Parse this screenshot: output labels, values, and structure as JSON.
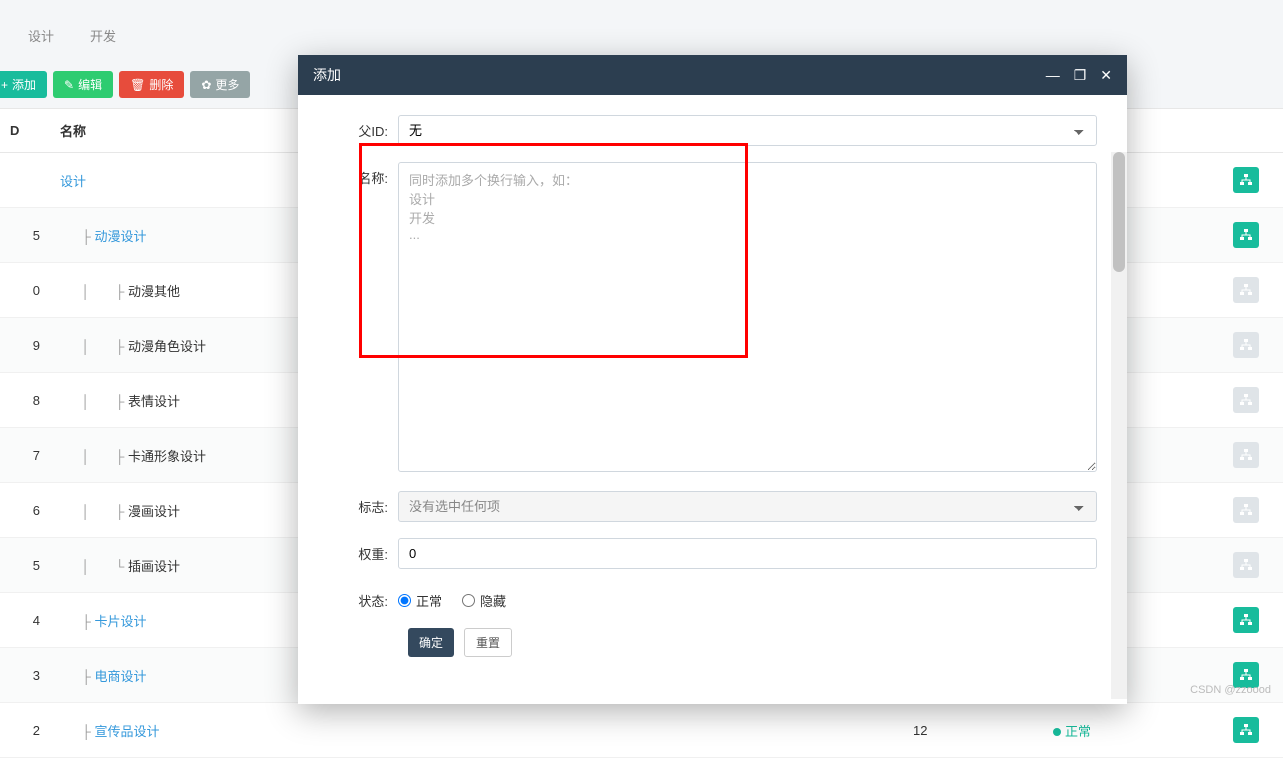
{
  "top_tabs": [
    "设计",
    "开发"
  ],
  "toolbar": {
    "add": "添加",
    "edit": "编辑",
    "delete": "删除",
    "more": "更多"
  },
  "table": {
    "headers": {
      "id": "D",
      "name": "名称"
    },
    "rows": [
      {
        "id": "",
        "indent": 0,
        "tree": "",
        "name": "设计",
        "link": true
      },
      {
        "id": "5",
        "indent": 1,
        "tree": "├",
        "name": "动漫设计",
        "link": true
      },
      {
        "id": "0",
        "indent": 2,
        "tree": "├",
        "pipe": true,
        "name": "动漫其他",
        "link": false
      },
      {
        "id": "9",
        "indent": 2,
        "tree": "├",
        "pipe": true,
        "name": "动漫角色设计",
        "link": false
      },
      {
        "id": "8",
        "indent": 2,
        "tree": "├",
        "pipe": true,
        "name": "表情设计",
        "link": false
      },
      {
        "id": "7",
        "indent": 2,
        "tree": "├",
        "pipe": true,
        "name": "卡通形象设计",
        "link": false
      },
      {
        "id": "6",
        "indent": 2,
        "tree": "├",
        "pipe": true,
        "name": "漫画设计",
        "link": false
      },
      {
        "id": "5",
        "indent": 2,
        "tree": "└",
        "pipe": true,
        "name": "插画设计",
        "link": false
      },
      {
        "id": "4",
        "indent": 1,
        "tree": "├",
        "name": "卡片设计",
        "link": true
      },
      {
        "id": "3",
        "indent": 1,
        "tree": "├",
        "name": "电商设计",
        "link": true
      },
      {
        "id": "2",
        "indent": 1,
        "tree": "├",
        "name": "宣传品设计",
        "link": true,
        "weight": "12",
        "status": "正常",
        "action_green": true
      }
    ]
  },
  "modal": {
    "title": "添加",
    "labels": {
      "parent": "父ID:",
      "name": "名称:",
      "flag": "标志:",
      "weight": "权重:",
      "status": "状态:"
    },
    "parent_value": "无",
    "name_placeholder": "同时添加多个换行输入，如：\n设计\n开发\n...",
    "flag_value": "没有选中任何项",
    "weight_value": "0",
    "status_options": {
      "normal": "正常",
      "hidden": "隐藏"
    },
    "buttons": {
      "ok": "确定",
      "reset": "重置"
    }
  },
  "watermark": "CSDN @zzoood"
}
